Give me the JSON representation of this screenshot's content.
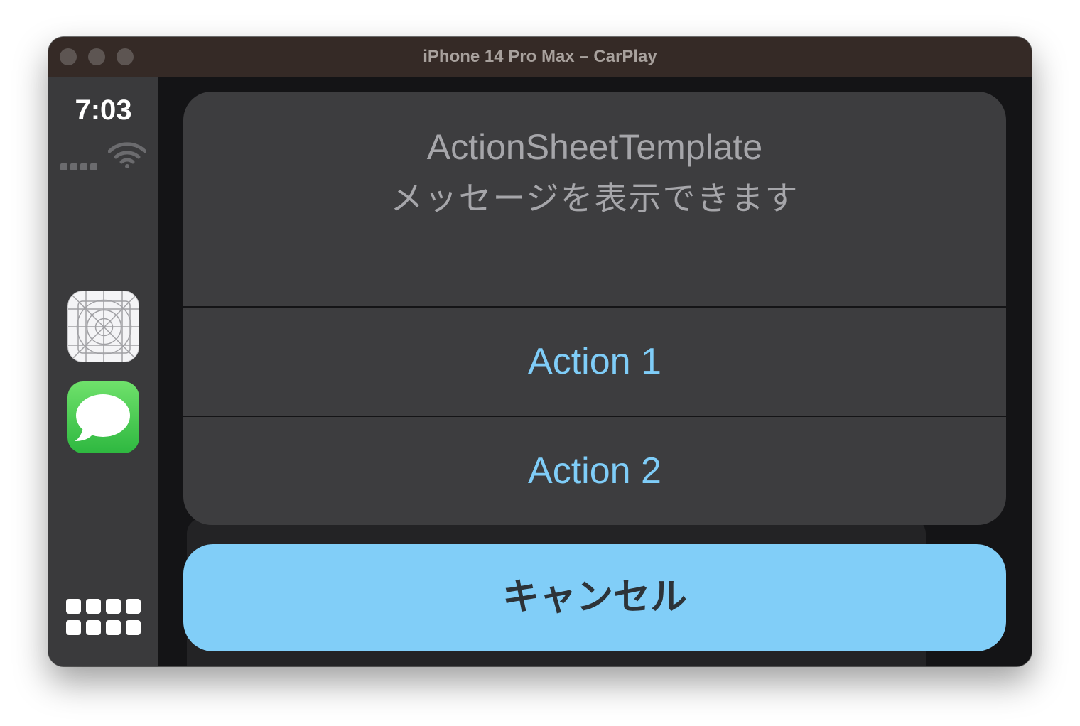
{
  "window": {
    "title": "iPhone 14 Pro Max – CarPlay"
  },
  "status_bar": {
    "time": "7:03",
    "icons": [
      "signal-dots-icon",
      "wifi-icon"
    ]
  },
  "sidebar": {
    "apps": [
      {
        "name": "template-app-icon"
      },
      {
        "name": "messages-app-icon"
      }
    ],
    "home_icon": "app-grid-icon"
  },
  "action_sheet": {
    "title": "ActionSheetTemplate",
    "message": "メッセージを表示できます",
    "actions": [
      {
        "label": "Action 1"
      },
      {
        "label": "Action 2"
      }
    ],
    "cancel_label": "キャンセル"
  },
  "colors": {
    "titlebar": "#352a26",
    "sidebar": "#3a3a3c",
    "sheet": "#3d3d3f",
    "action_text": "#7fcdf8",
    "cancel_bg": "#81cef8",
    "cancel_text": "#2d3338"
  }
}
